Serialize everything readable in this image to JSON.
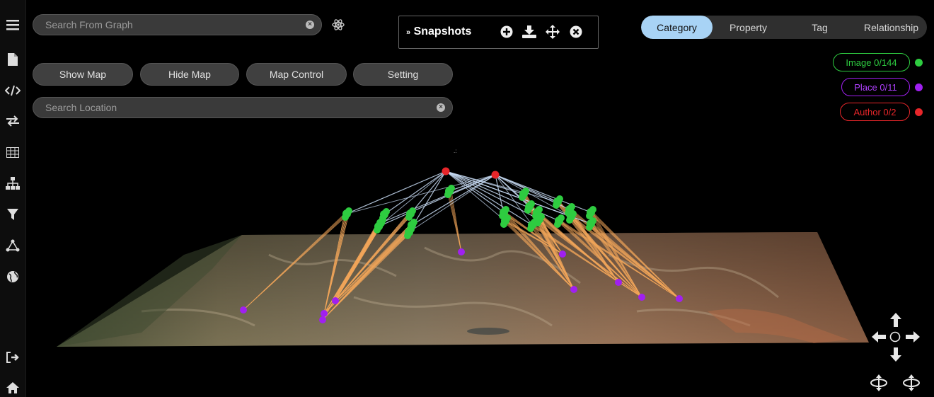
{
  "search_graph": {
    "placeholder": "Search From Graph"
  },
  "search_location": {
    "placeholder": "Search Location"
  },
  "buttons": {
    "show_map": "Show Map",
    "hide_map": "Hide Map",
    "map_control": "Map Control",
    "setting": "Setting"
  },
  "snapshots": {
    "title": "Snapshots"
  },
  "tabs": [
    "Category",
    "Property",
    "Tag",
    "Relationship"
  ],
  "active_tab": "Category",
  "legend": [
    {
      "label": "Image 0/144",
      "color": "#2ecc40"
    },
    {
      "label": "Place 0/11",
      "color": "#a020f0"
    },
    {
      "label": "Author 0/2",
      "color": "#e8262a"
    }
  ],
  "icons": {
    "sidebar": [
      "menu-icon",
      "file-icon",
      "code-icon",
      "swap-icon",
      "table-icon",
      "hierarchy-icon",
      "filter-icon",
      "network-icon",
      "globe-icon",
      "logout-icon",
      "home-icon"
    ],
    "snapshot_tools": [
      "add-circle-icon",
      "download-icon",
      "move-icon",
      "close-circle-icon"
    ]
  }
}
